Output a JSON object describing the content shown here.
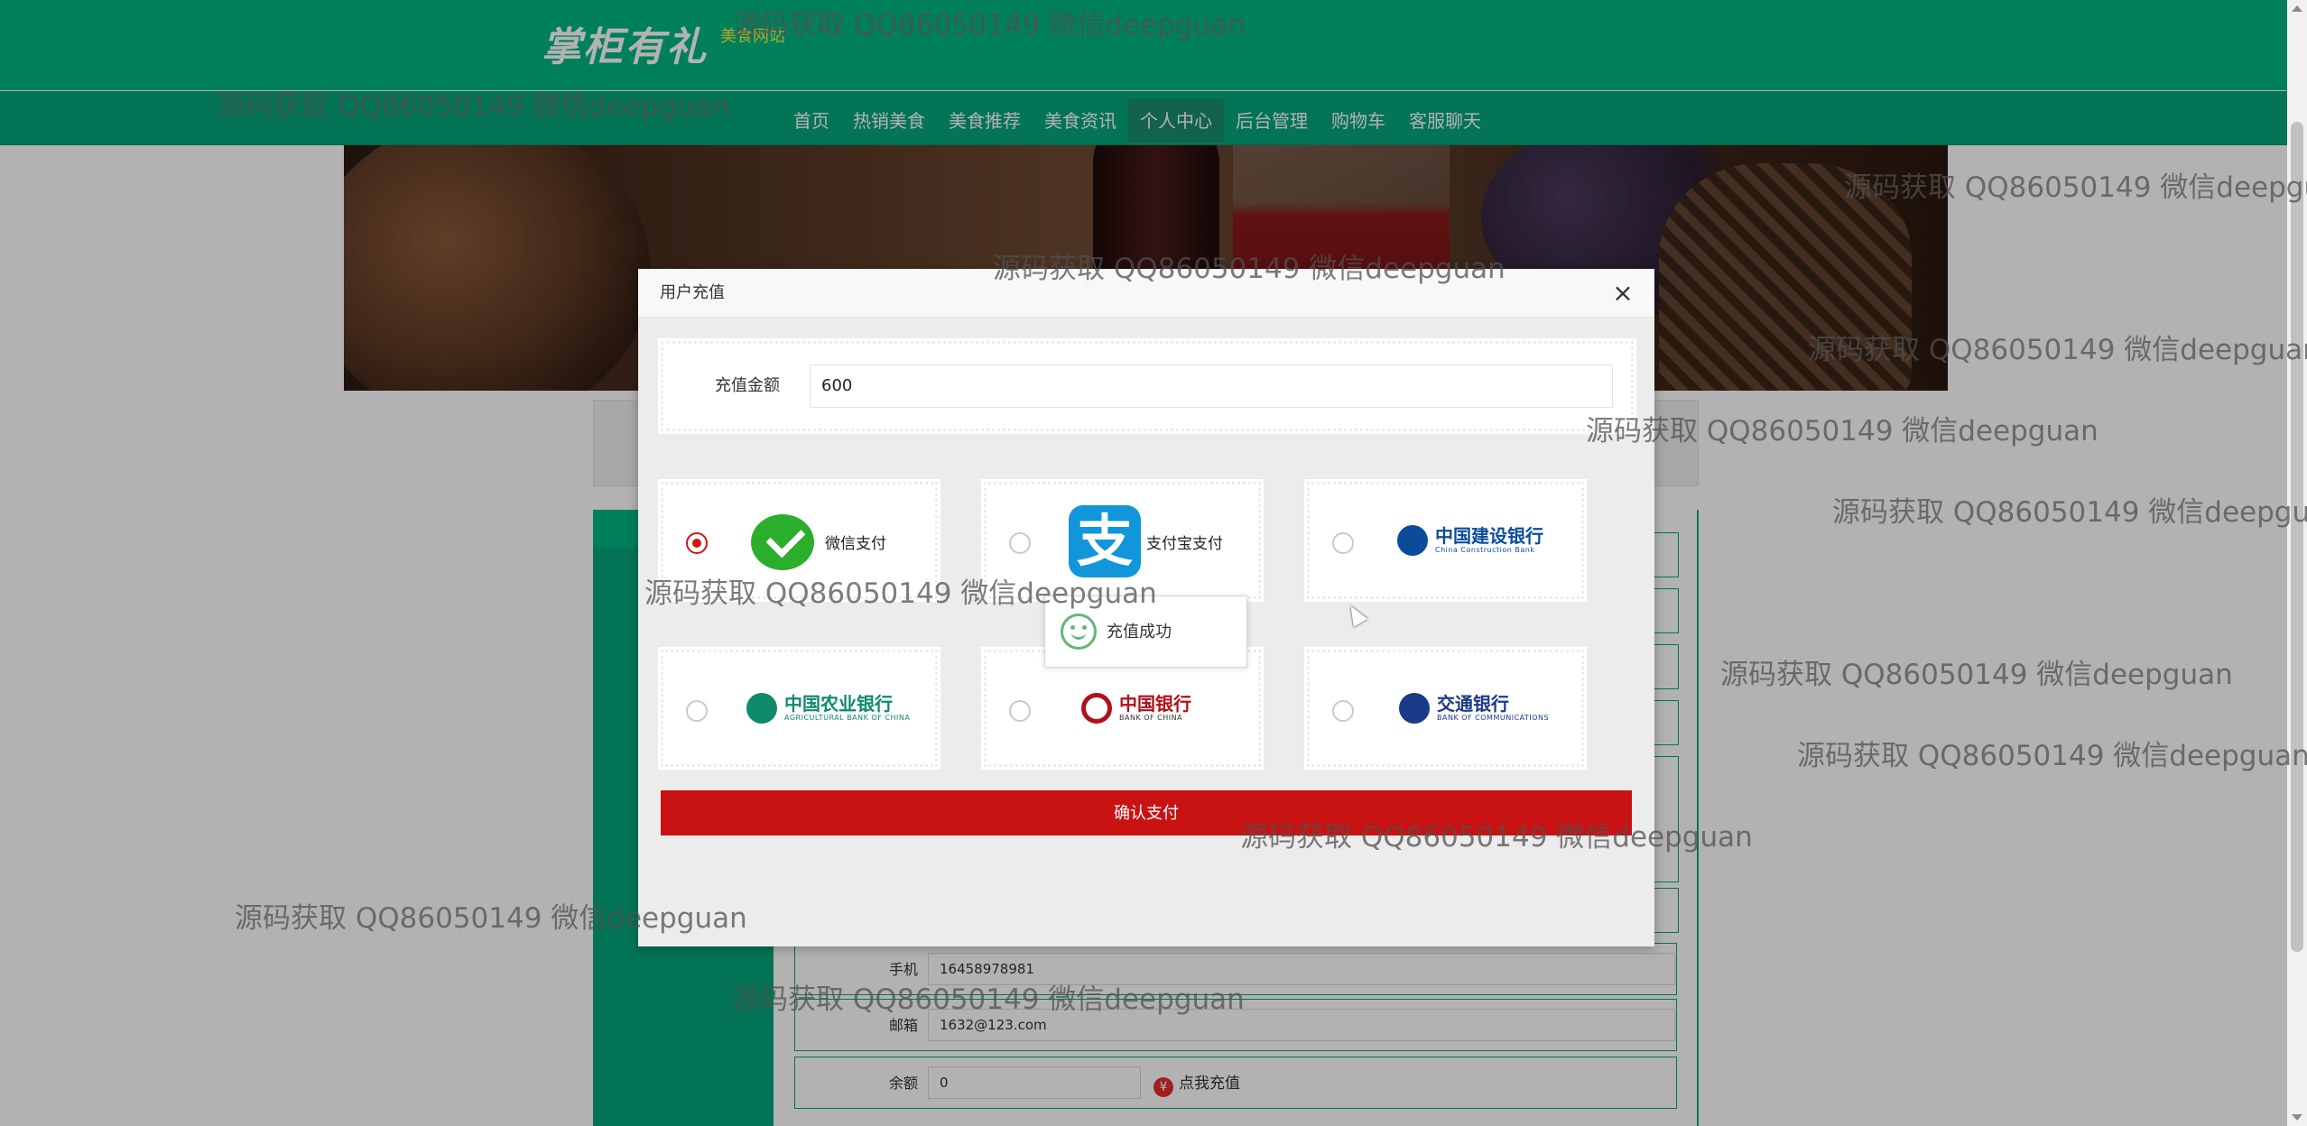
{
  "header": {
    "logo_text": "掌柜有礼",
    "logo_sub": "美食网站",
    "nav": [
      "首页",
      "热销美食",
      "美食推荐",
      "美食资讯",
      "个人中心",
      "后台管理",
      "购物车",
      "客服聊天"
    ],
    "active_nav": "个人中心"
  },
  "profile": {
    "rows": [
      {
        "label": "手机",
        "value": "16458978981"
      },
      {
        "label": "邮箱",
        "value": "1632@123.com"
      },
      {
        "label": "余额",
        "value": "0"
      }
    ],
    "recharge_link": "点我充值",
    "recharge_symbol": "¥"
  },
  "modal": {
    "title": "用户充值",
    "close": "×",
    "amount_label": "充值金额",
    "amount_value": "600",
    "payments": [
      {
        "name": "微信支付",
        "icon": "wechat-pay-icon",
        "checked": true
      },
      {
        "name": "支付宝支付",
        "icon": "alipay-icon",
        "checked": false
      },
      {
        "name": "",
        "icon": "ccb-bank-logo",
        "checked": false
      },
      {
        "name": "",
        "icon": "abc-bank-logo",
        "checked": false
      },
      {
        "name": "",
        "icon": "boc-bank-logo",
        "checked": false
      },
      {
        "name": "",
        "icon": "bocom-bank-logo",
        "checked": false
      }
    ],
    "banks": {
      "ccb": {
        "cn": "中国建设银行",
        "en": "China Construction Bank"
      },
      "abc": {
        "cn": "中国农业银行",
        "en": "AGRICULTURAL BANK OF CHINA"
      },
      "boc": {
        "cn": "中国银行",
        "en": "BANK OF CHINA"
      },
      "bocom": {
        "cn": "交通银行",
        "en": "BANK OF COMMUNICATIONS"
      }
    },
    "alipay_glyph": "支",
    "confirm_label": "确认支付"
  },
  "toast": {
    "text": "充值成功"
  },
  "watermark": "源码获取 QQ86050149 微信deepguan",
  "colors": {
    "primary": "#00b683",
    "nav": "#05a77a",
    "confirm": "#c91212",
    "success": "#5fb878"
  }
}
